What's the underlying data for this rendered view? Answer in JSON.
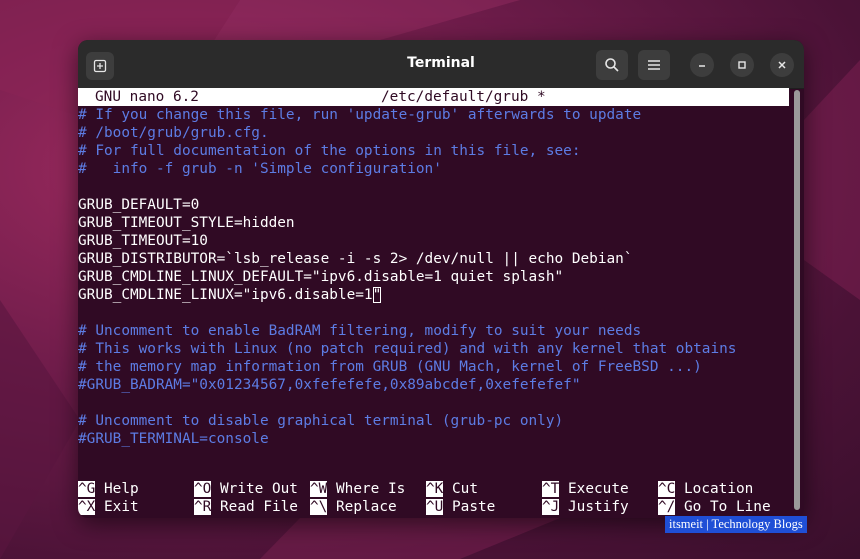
{
  "window": {
    "title": "Terminal"
  },
  "titlebar_icons": {
    "new_tab": "new-tab-icon",
    "search": "search-icon",
    "menu": "hamburger-menu-icon",
    "minimize": "minimize-icon",
    "maximize": "maximize-icon",
    "close": "close-icon"
  },
  "nano": {
    "version": "GNU nano 6.2",
    "file": "/etc/default/grub *"
  },
  "editor_lines": [
    "# If you change this file, run 'update-grub' afterwards to update",
    "# /boot/grub/grub.cfg.",
    "# For full documentation of the options in this file, see:",
    "#   info -f grub -n 'Simple configuration'",
    "",
    "GRUB_DEFAULT=0",
    "GRUB_TIMEOUT_STYLE=hidden",
    "GRUB_TIMEOUT=10",
    "GRUB_DISTRIBUTOR=`lsb_release -i -s 2> /dev/null || echo Debian`",
    "GRUB_CMDLINE_LINUX_DEFAULT=\"ipv6.disable=1 quiet splash\"",
    "GRUB_CMDLINE_LINUX=\"ipv6.disable=1",
    "",
    "# Uncomment to enable BadRAM filtering, modify to suit your needs",
    "# This works with Linux (no patch required) and with any kernel that obtains",
    "# the memory map information from GRUB (GNU Mach, kernel of FreeBSD ...)",
    "#GRUB_BADRAM=\"0x01234567,0xfefefefe,0x89abcdef,0xefefefef\"",
    "",
    "# Uncomment to disable graphical terminal (grub-pc only)",
    "#GRUB_TERMINAL=console"
  ],
  "cursor_char": "\"",
  "shortcuts": [
    [
      {
        "key": "^G",
        "label": "Help"
      },
      {
        "key": "^O",
        "label": "Write Out"
      },
      {
        "key": "^W",
        "label": "Where Is"
      },
      {
        "key": "^K",
        "label": "Cut"
      },
      {
        "key": "^T",
        "label": "Execute"
      },
      {
        "key": "^C",
        "label": "Location"
      }
    ],
    [
      {
        "key": "^X",
        "label": "Exit"
      },
      {
        "key": "^R",
        "label": "Read File"
      },
      {
        "key": "^\\",
        "label": "Replace"
      },
      {
        "key": "^U",
        "label": "Paste"
      },
      {
        "key": "^J",
        "label": "Justify"
      },
      {
        "key": "^/",
        "label": "Go To Line"
      }
    ]
  ],
  "watermark": "itsmeit | Technology Blogs",
  "colors": {
    "terminal_bg": "#300a24",
    "comment": "#5d7ce4",
    "titlebar": "#2b2b2b"
  }
}
